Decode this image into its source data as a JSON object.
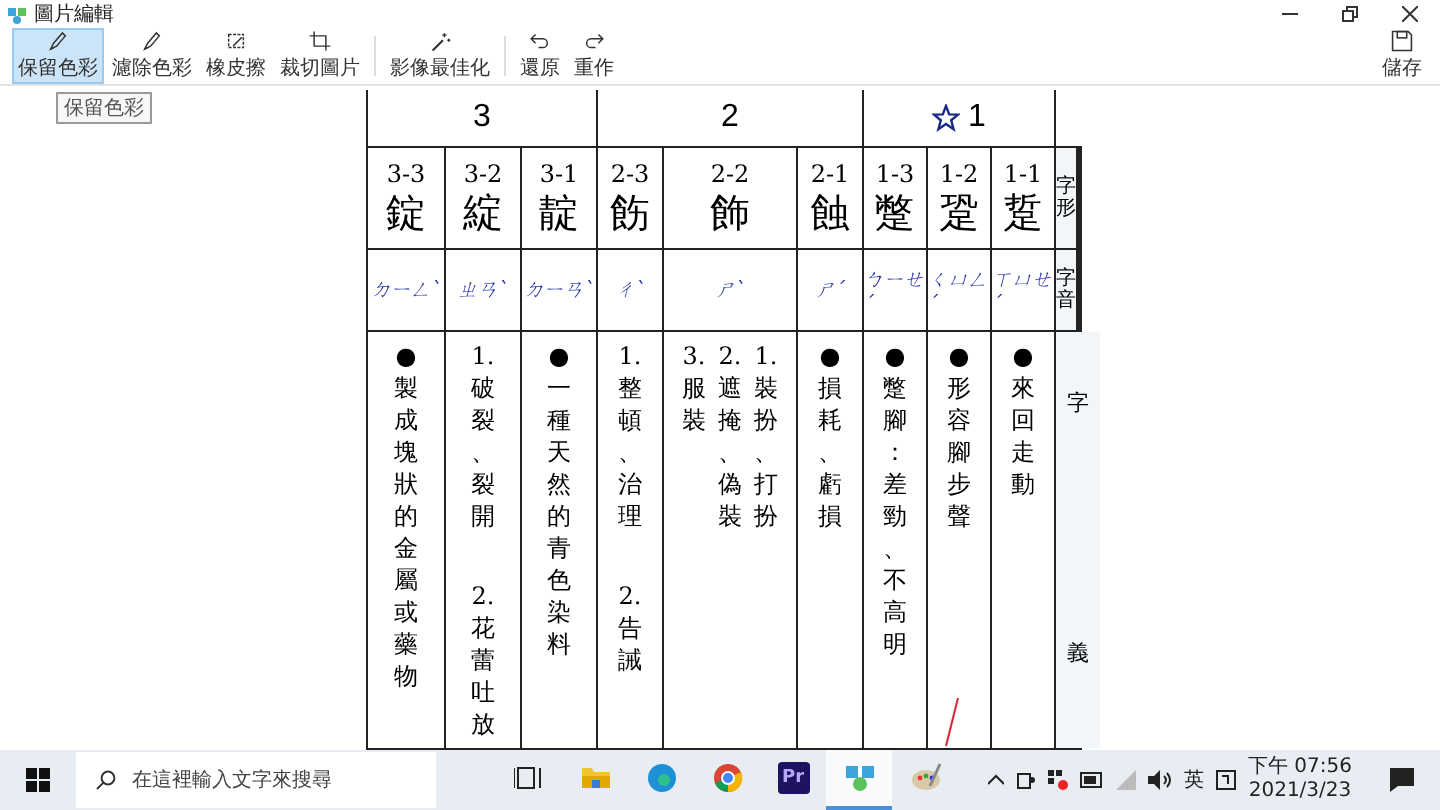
{
  "window": {
    "title": "圖片編輯"
  },
  "toolbar": [
    {
      "label": "保留色彩",
      "selected": true
    },
    {
      "label": "濾除色彩",
      "selected": false
    },
    {
      "label": "橡皮擦",
      "selected": false
    },
    {
      "label": "裁切圖片",
      "selected": false
    },
    {
      "label": "影像最佳化",
      "selected": false
    },
    {
      "label": "還原",
      "selected": false
    },
    {
      "label": "重作",
      "selected": false
    }
  ],
  "save_button": {
    "label": "儲存"
  },
  "tooltip": "保留色彩",
  "document": {
    "groups": [
      {
        "label": "3",
        "starred": false
      },
      {
        "label": "2",
        "starred": false
      },
      {
        "label": "1",
        "starred": true
      }
    ],
    "entries": [
      {
        "code": "3-3",
        "char": "錠",
        "phonetic": "ㄉㄧㄥˋ",
        "meaning_columns": [
          [
            {
              "marker": "●",
              "text": "製成塊狀的金屬或藥物"
            }
          ]
        ]
      },
      {
        "code": "3-2",
        "char": "綻",
        "phonetic": "ㄓㄢˋ",
        "meaning_columns": [
          [
            {
              "marker": "1.",
              "text": "破裂、裂開"
            },
            {
              "marker": "2.",
              "text": "花蕾吐放"
            }
          ]
        ]
      },
      {
        "code": "3-1",
        "char": "靛",
        "phonetic": "ㄉㄧㄢˋ",
        "meaning_columns": [
          [
            {
              "marker": "●",
              "text": "一種天然的青色染料"
            }
          ]
        ]
      },
      {
        "code": "2-3",
        "char": "飭",
        "phonetic": "ㄔˋ",
        "meaning_columns": [
          [
            {
              "marker": "1.",
              "text": "整頓、治理"
            },
            {
              "marker": "2.",
              "text": "告誡"
            }
          ]
        ]
      },
      {
        "code": "2-2",
        "char": "飾",
        "phonetic": "ㄕˋ",
        "meaning_columns": [
          [
            {
              "marker": "3.",
              "text": "服裝"
            }
          ],
          [
            {
              "marker": "2.",
              "text": "遮掩、偽裝"
            }
          ],
          [
            {
              "marker": "1.",
              "text": "裝扮、打扮"
            }
          ]
        ]
      },
      {
        "code": "2-1",
        "char": "蝕",
        "phonetic": "ㄕˊ",
        "meaning_columns": [
          [
            {
              "marker": "●",
              "text": "損耗、虧損"
            }
          ]
        ]
      },
      {
        "code": "1-3",
        "char": "蹩",
        "phonetic": "ㄅㄧㄝˊ",
        "meaning_columns": [
          [
            {
              "marker": "●",
              "text": "蹩腳：差勁、不高明"
            }
          ]
        ]
      },
      {
        "code": "1-2",
        "char": "跫",
        "phonetic": "ㄑㄩㄥˊ",
        "meaning_columns": [
          [
            {
              "marker": "●",
              "text": "形容腳步聲"
            }
          ]
        ]
      },
      {
        "code": "1-1",
        "char": "踅",
        "phonetic": "ㄒㄩㄝˊ",
        "meaning_columns": [
          [
            {
              "marker": "●",
              "text": "來回走動"
            }
          ]
        ]
      }
    ],
    "row_labels": [
      "字形",
      "字音"
    ],
    "meaning_label": [
      "字",
      "義"
    ]
  },
  "taskbar": {
    "search": {
      "placeholder": "在這裡輸入文字來搜尋"
    },
    "apps": [
      {
        "kind": "taskview"
      },
      {
        "kind": "folder"
      },
      {
        "kind": "edge"
      },
      {
        "kind": "chrome"
      },
      {
        "kind": "premiere",
        "label": "Pr"
      },
      {
        "kind": "editor",
        "selected": true
      },
      {
        "kind": "paint",
        "selected": false
      }
    ],
    "input_method": "英",
    "time": "下午 07:56",
    "date": "2021/3/23"
  }
}
